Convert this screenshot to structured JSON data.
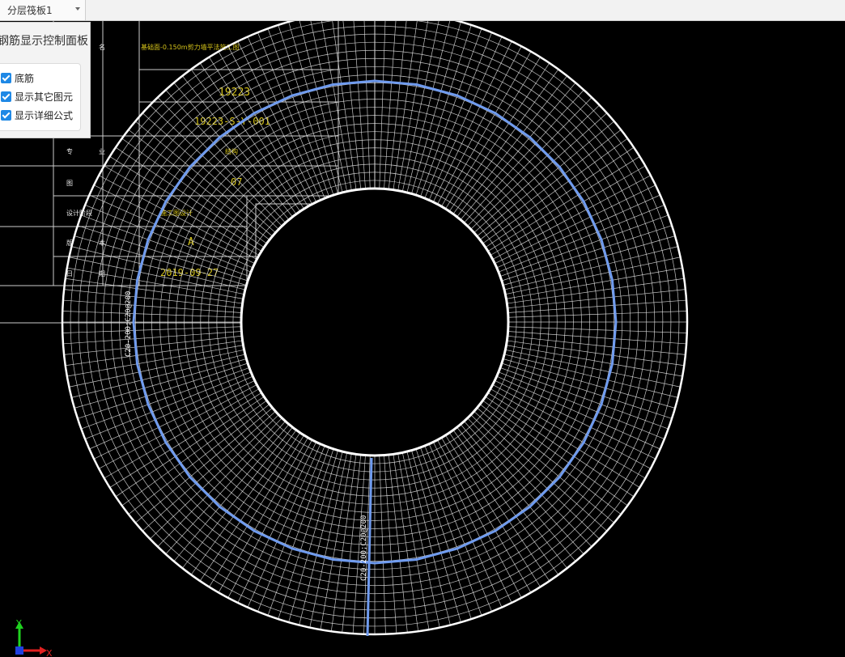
{
  "toolbar": {
    "layer_select_value": "分层筏板1"
  },
  "panel": {
    "title": "钢筋显示控制面板",
    "options": [
      {
        "label": "底筋",
        "checked": true
      },
      {
        "label": "显示其它图元",
        "checked": true
      },
      {
        "label": "显示详细公式",
        "checked": true
      }
    ]
  },
  "drawing": {
    "title_block": {
      "project_name": "基础面-0.150m剪力墙平法施工图",
      "project_no": "19223",
      "drawing_no": "19223-S-Y-001",
      "discipline": "结构",
      "sheet": "07",
      "design_stage": "施工图设计",
      "version": "A",
      "date": "2019-09-27",
      "labels": [
        "名",
        "专",
        "业",
        "图",
        "设计阶段",
        "版",
        "本",
        "日",
        "期"
      ]
    },
    "rebar_labels": [
      "C20-200;C20@200",
      "C20-200;C20@200"
    ],
    "colors": {
      "background": "#000000",
      "grid": "#ffffff",
      "rebar_ring": "#6f9bef",
      "title_text": "#d4c21a",
      "outline": "#ffffff"
    }
  },
  "axis": {
    "x_label": "X",
    "y_label": "Y"
  }
}
